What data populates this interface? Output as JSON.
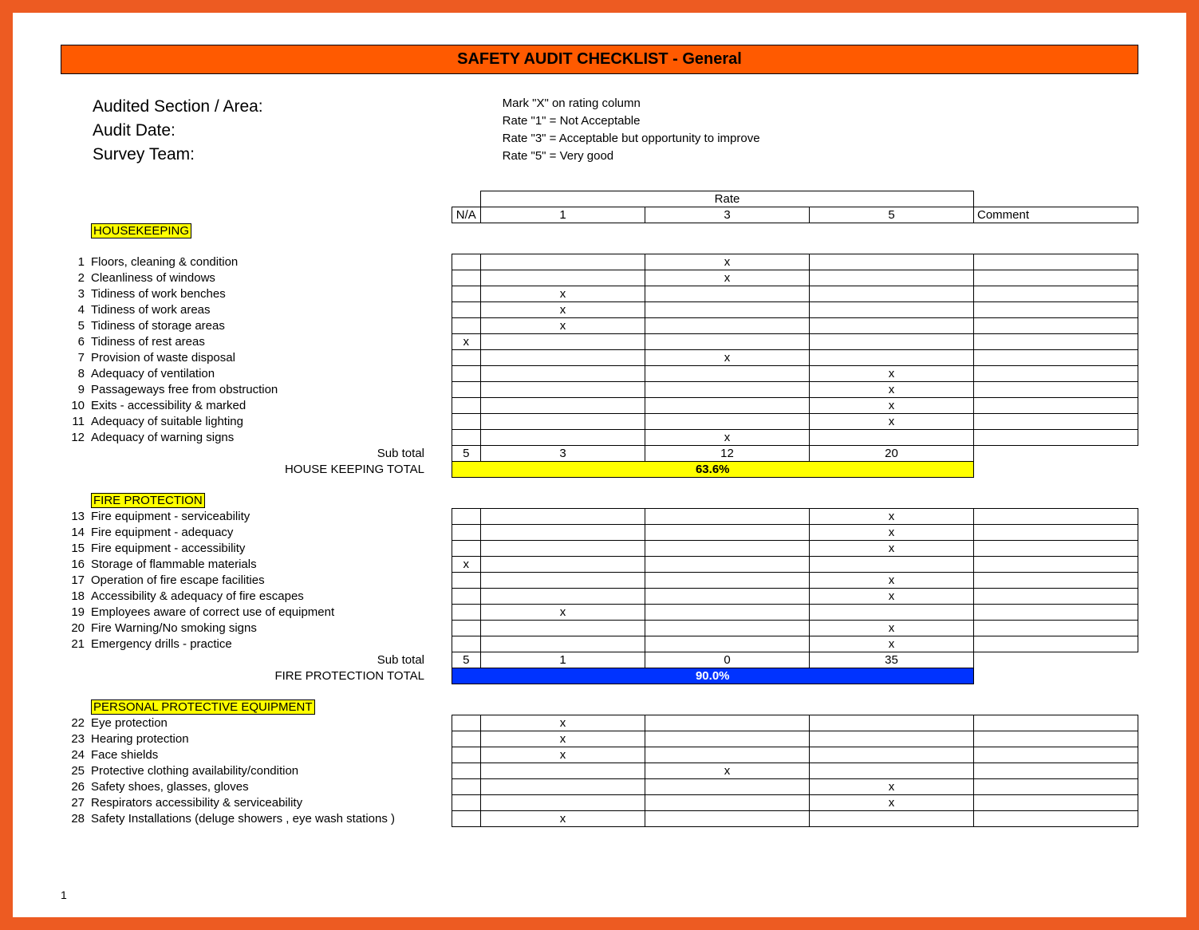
{
  "title": "SAFETY AUDIT CHECKLIST - General",
  "meta_left": {
    "line1": "Audited Section / Area:",
    "line2": "Audit Date:",
    "line3": "Survey Team:"
  },
  "meta_right": {
    "line1": "Mark \"X\" on rating column",
    "line2": "Rate \"1\" = Not Acceptable",
    "line3": "Rate \"3\" = Acceptable but opportunity to improve",
    "line4": "Rate \"5\" = Very good"
  },
  "columns": {
    "rate": "Rate",
    "na": "N/A",
    "c1": "1",
    "c3": "3",
    "c5": "5",
    "comment": "Comment"
  },
  "labels": {
    "subtotal": "Sub total"
  },
  "page": "1",
  "sections": [
    {
      "name": "HOUSEKEEPING",
      "total_label": "HOUSE KEEPING TOTAL",
      "total_value": "63.6%",
      "total_style": "yellow",
      "subtotal": {
        "na": "5",
        "c1": "3",
        "c3": "12",
        "c5": "20"
      },
      "items": [
        {
          "n": "1",
          "t": "Floors, cleaning & condition",
          "mark": "c3"
        },
        {
          "n": "2",
          "t": "Cleanliness of windows",
          "mark": "c3"
        },
        {
          "n": "3",
          "t": "Tidiness of work benches",
          "mark": "c1"
        },
        {
          "n": "4",
          "t": "Tidiness of work areas",
          "mark": "c1"
        },
        {
          "n": "5",
          "t": "Tidiness of storage areas",
          "mark": "c1"
        },
        {
          "n": "6",
          "t": "Tidiness of rest areas",
          "mark": "na"
        },
        {
          "n": "7",
          "t": "Provision of waste disposal",
          "mark": "c3"
        },
        {
          "n": "8",
          "t": "Adequacy of ventilation",
          "mark": "c5"
        },
        {
          "n": "9",
          "t": "Passageways free from obstruction",
          "mark": "c5"
        },
        {
          "n": "10",
          "t": "Exits - accessibility & marked",
          "mark": "c5"
        },
        {
          "n": "11",
          "t": "Adequacy of suitable lighting",
          "mark": "c5"
        },
        {
          "n": "12",
          "t": "Adequacy of warning signs",
          "mark": "c3"
        }
      ]
    },
    {
      "name": "FIRE PROTECTION",
      "total_label": "FIRE PROTECTION TOTAL",
      "total_value": "90.0%",
      "total_style": "blue",
      "subtotal": {
        "na": "5",
        "c1": "1",
        "c3": "0",
        "c5": "35"
      },
      "items": [
        {
          "n": "13",
          "t": "Fire equipment - serviceability",
          "mark": "c5"
        },
        {
          "n": "14",
          "t": "Fire equipment - adequacy",
          "mark": "c5"
        },
        {
          "n": "15",
          "t": "Fire equipment - accessibility",
          "mark": "c5"
        },
        {
          "n": "16",
          "t": "Storage of flammable materials",
          "mark": "na"
        },
        {
          "n": "17",
          "t": "Operation of fire escape facilities",
          "mark": "c5"
        },
        {
          "n": "18",
          "t": "Accessibility & adequacy of fire escapes",
          "mark": "c5"
        },
        {
          "n": "19",
          "t": "Employees aware of correct use of equipment",
          "mark": "c1"
        },
        {
          "n": "20",
          "t": "Fire Warning/No smoking signs",
          "mark": "c5"
        },
        {
          "n": "21",
          "t": "Emergency drills - practice",
          "mark": "c5"
        }
      ]
    },
    {
      "name": "PERSONAL PROTECTIVE EQUIPMENT",
      "total_label": null,
      "total_value": null,
      "total_style": null,
      "subtotal": null,
      "items": [
        {
          "n": "22",
          "t": "Eye protection",
          "mark": "c1"
        },
        {
          "n": "23",
          "t": "Hearing protection",
          "mark": "c1"
        },
        {
          "n": "24",
          "t": "Face shields",
          "mark": "c1"
        },
        {
          "n": "25",
          "t": "Protective clothing availability/condition",
          "mark": "c3"
        },
        {
          "n": "26",
          "t": "Safety shoes, glasses, gloves",
          "mark": "c5"
        },
        {
          "n": "27",
          "t": "Respirators accessibility & serviceability",
          "mark": "c5"
        },
        {
          "n": "28",
          "t": "Safety Installations (deluge showers , eye wash stations )",
          "mark": "c1"
        }
      ]
    }
  ]
}
